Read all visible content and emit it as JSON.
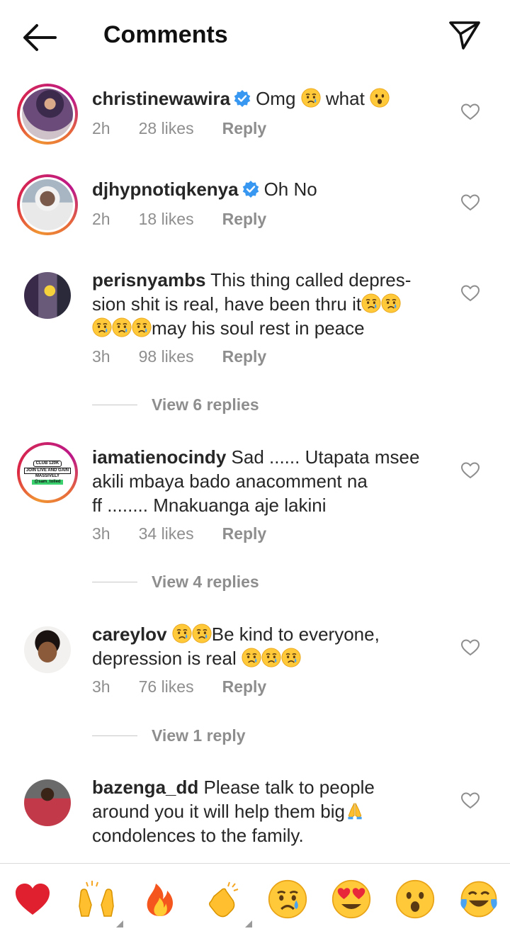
{
  "header": {
    "title": "Comments"
  },
  "comments": [
    {
      "username": "christinewawira",
      "verified": true,
      "text": "Omg",
      "text2": "what",
      "time": "2h",
      "likes": "28 likes",
      "reply": "Reply"
    },
    {
      "username": "djhypnotiqkenya",
      "verified": true,
      "text": "Oh No",
      "time": "2h",
      "likes": "18 likes",
      "reply": "Reply"
    },
    {
      "username": "perisnyambs",
      "text_l1": "This thing called depres-",
      "text_l2": "sion shit is real, have been thru it",
      "text_l3": "may his soul rest in peace",
      "time": "3h",
      "likes": "98 likes",
      "reply": "Reply",
      "view_replies": "View 6 replies"
    },
    {
      "username": "iamatienocindy",
      "text_l1": "Sad ...... Utapata msee",
      "text_l2": "akili mbaya bado anacomment na",
      "text_l3": "ff ........ Mnakuanga aje lakini",
      "time": "3h",
      "likes": "34 likes",
      "reply": "Reply",
      "view_replies": "View 4 replies",
      "avatar_text": {
        "a": "CLUB 120K",
        "b": "JOIN LIVE AND GAIN",
        "c": "MASSIVELY",
        "d": "@sam_tolled"
      }
    },
    {
      "username": "careylov",
      "text_l1": "Be kind to everyone,",
      "text_l2": "depression is real",
      "time": "3h",
      "likes": "76 likes",
      "reply": "Reply",
      "view_replies": "View 1 reply"
    },
    {
      "username": "bazenga_dd",
      "text_l1": "Please talk to people",
      "text_l2": "around you it will help them big",
      "text_l3": "condolences to the family."
    }
  ],
  "quick_reactions": [
    "red-heart",
    "raising-hands",
    "fire",
    "clapping-hands",
    "crying-face",
    "heart-eyes-face",
    "astonished-face",
    "tears-of-joy-face"
  ],
  "colors": {
    "accent": "#3897f0",
    "muted": "#8e8e8e",
    "text": "#262626"
  }
}
